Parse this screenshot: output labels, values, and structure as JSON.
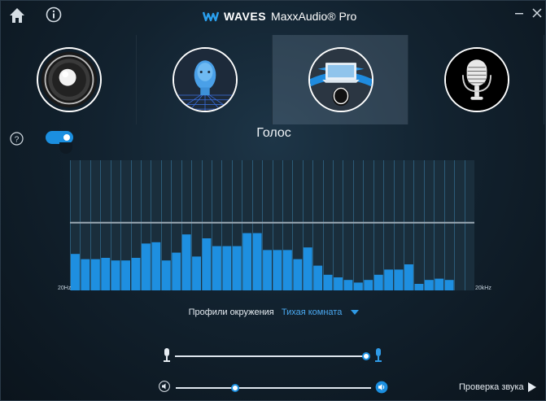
{
  "titlebar": {
    "brand_name": "WAVES",
    "product_name": "MaxxAudio® Pro",
    "icons": [
      "home-icon",
      "info-icon",
      "waves-logo-icon",
      "minimize-icon",
      "close-icon"
    ]
  },
  "modes": [
    {
      "id": "speaker",
      "icon": "speaker-icon",
      "active": false
    },
    {
      "id": "head",
      "icon": "head-icon",
      "active": false
    },
    {
      "id": "laptop-voice",
      "icon": "laptop-user-icon",
      "active": true
    },
    {
      "id": "microphone",
      "icon": "microphone-icon",
      "active": false
    }
  ],
  "section": {
    "title": "Голос",
    "toggle_on": true
  },
  "eq": {
    "min_label": "20Hz",
    "max_label": "20kHz",
    "colors": {
      "bar": "#1e8fe0",
      "grid": "#4fb0e8",
      "curve": "#9aa8b3",
      "bg": "#1a2e3c"
    }
  },
  "chart_data": {
    "type": "bar",
    "title": "",
    "x_range": [
      "20Hz",
      "20kHz"
    ],
    "values": [
      0.28,
      0.24,
      0.24,
      0.25,
      0.23,
      0.23,
      0.25,
      0.36,
      0.37,
      0.23,
      0.29,
      0.43,
      0.26,
      0.4,
      0.34,
      0.34,
      0.34,
      0.44,
      0.44,
      0.31,
      0.31,
      0.31,
      0.24,
      0.33,
      0.19,
      0.12,
      0.1,
      0.08,
      0.06,
      0.08,
      0.12,
      0.16,
      0.16,
      0.2,
      0.05,
      0.08,
      0.09,
      0.08
    ],
    "curve_level": 0.52,
    "ylim": [
      0,
      1
    ]
  },
  "profile": {
    "label": "Профили окружения",
    "value": "Тихая комната"
  },
  "mic_slider": {
    "level": 0.98
  },
  "volume_slider": {
    "level": 0.3
  },
  "sound_check_label": "Проверка звука"
}
